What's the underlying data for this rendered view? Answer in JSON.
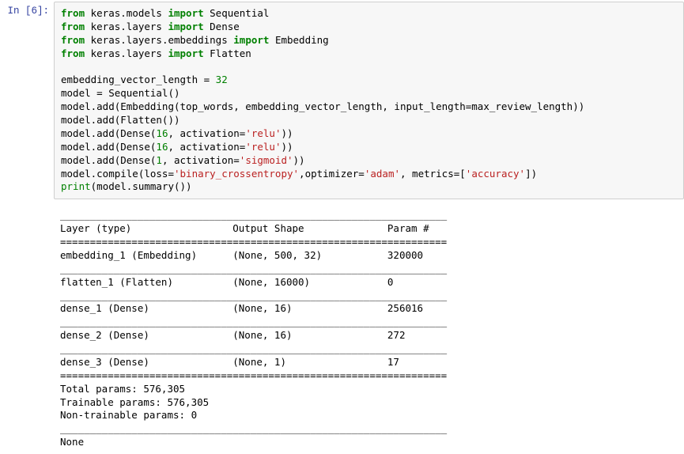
{
  "prompt": {
    "label": "In [6]:"
  },
  "code": {
    "l1a": "from",
    "l1b": " keras.models ",
    "l1c": "import",
    "l1d": " Sequential",
    "l2a": "from",
    "l2b": " keras.layers ",
    "l2c": "import",
    "l2d": " Dense",
    "l3a": "from",
    "l3b": " keras.layers.embeddings ",
    "l3c": "import",
    "l3d": " Embedding",
    "l4a": "from",
    "l4b": " keras.layers ",
    "l4c": "import",
    "l4d": " Flatten",
    "blank1": "",
    "l5a": "embedding_vector_length = ",
    "l5b": "32",
    "l6": "model = Sequential()",
    "l7": "model.add(Embedding(top_words, embedding_vector_length, input_length=max_review_length))",
    "l8": "model.add(Flatten())",
    "l9a": "model.add(Dense(",
    "l9b": "16",
    "l9c": ", activation=",
    "l9d": "'relu'",
    "l9e": "))",
    "l10a": "model.add(Dense(",
    "l10b": "16",
    "l10c": ", activation=",
    "l10d": "'relu'",
    "l10e": "))",
    "l11a": "model.add(Dense(",
    "l11b": "1",
    "l11c": ", activation=",
    "l11d": "'sigmoid'",
    "l11e": "))",
    "l12a": "model.compile(loss=",
    "l12b": "'binary_crossentropy'",
    "l12c": ",optimizer=",
    "l12d": "'adam'",
    "l12e": ", metrics=[",
    "l12f": "'accuracy'",
    "l12g": "])",
    "l13a": "print",
    "l13b": "(model.summary())"
  },
  "output": {
    "sep_us": "_________________________________________________________________",
    "header": "Layer (type)                 Output Shape              Param #   ",
    "sep_eq": "=================================================================",
    "row1": "embedding_1 (Embedding)      (None, 500, 32)           320000    ",
    "row2": "flatten_1 (Flatten)          (None, 16000)             0         ",
    "row3": "dense_1 (Dense)              (None, 16)                256016    ",
    "row4": "dense_2 (Dense)              (None, 16)                272       ",
    "row5": "dense_3 (Dense)              (None, 1)                 17        ",
    "total": "Total params: 576,305",
    "trainable": "Trainable params: 576,305",
    "nontrain": "Non-trainable params: 0",
    "none": "None"
  }
}
